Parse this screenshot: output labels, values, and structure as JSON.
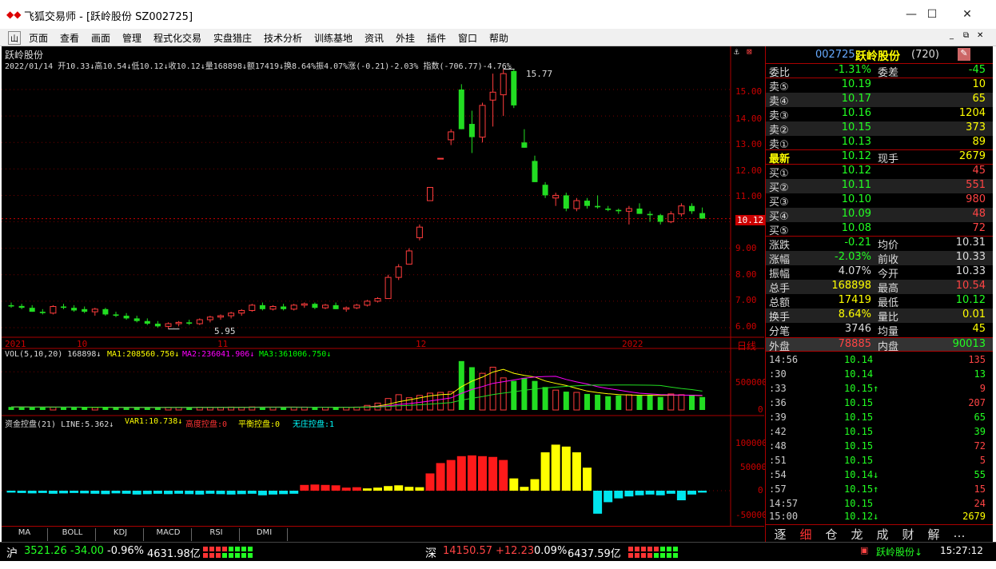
{
  "window": {
    "title": "飞狐交易师 - [跃岭股份 SZ002725]",
    "minimize": "—",
    "maximize": "☐",
    "close": "✕"
  },
  "menu": {
    "icon": "山",
    "items": [
      "页面",
      "查看",
      "画面",
      "管理",
      "程式化交易",
      "实盘猎庄",
      "技术分析",
      "训练基地",
      "资讯",
      "外挂",
      "插件",
      "窗口",
      "帮助"
    ]
  },
  "chart": {
    "stock_name": "跃岭股份",
    "info_line": "2022/01/14 开10.33↓高10.54↓低10.12↓收10.12↓量168898↓额17419↓换8.64%振4.07%涨(-0.21)-2.03% 指数(-706.77)-4.76%",
    "price_ticks": [
      "15.00",
      "14.00",
      "13.00",
      "12.00",
      "11.00",
      "10.12",
      "9.00",
      "8.00",
      "7.00",
      "6.00"
    ],
    "current_price": "10.12",
    "max_label": "15.77",
    "min_label": "5.95",
    "x_labels": [
      "2021",
      "10",
      "11",
      "12",
      "2022"
    ],
    "period": "日线",
    "vol_legend": {
      "main": "VOL(5,10,20) 168898↓",
      "ma1": "MA1:208560.750↓",
      "ma2": "MA2:236041.906↓",
      "ma3": "MA3:361006.750↓"
    },
    "vol_ticks": [
      "500000",
      "0"
    ],
    "fund_legend": {
      "main": "资金控盘(21) LINE:5.362↓",
      "var1": "VAR1:10.738↓",
      "high": "高度控盘:0",
      "balance": "平衡控盘:0",
      "none": "无庄控盘:1"
    },
    "fund_ticks": [
      "100000",
      "50000",
      "0",
      "-50000"
    ],
    "colors": {
      "up": "#ff3c3c",
      "down": "#22dd22",
      "ma1": "#ffffff",
      "ma2": "#ffff00",
      "ma3": "#ff00ff"
    }
  },
  "indicator_tabs": [
    "MA",
    "BOLL",
    "KDJ",
    "MACD",
    "RSI",
    "DMI"
  ],
  "chart_data": {
    "type": "candlestick",
    "series": [
      {
        "name": "daily",
        "ohlc": [
          [
            6.85,
            6.95,
            6.75,
            6.8
          ],
          [
            6.82,
            6.9,
            6.7,
            6.75
          ],
          [
            6.75,
            6.85,
            6.6,
            6.6
          ],
          [
            6.6,
            6.7,
            6.5,
            6.55
          ],
          [
            6.55,
            6.85,
            6.5,
            6.8
          ],
          [
            6.8,
            6.9,
            6.7,
            6.75
          ],
          [
            6.75,
            6.85,
            6.6,
            6.65
          ],
          [
            6.7,
            6.8,
            6.55,
            6.6
          ],
          [
            6.6,
            6.75,
            6.45,
            6.7
          ],
          [
            6.7,
            6.75,
            6.45,
            6.5
          ],
          [
            6.5,
            6.6,
            6.4,
            6.45
          ],
          [
            6.45,
            6.55,
            6.3,
            6.35
          ],
          [
            6.35,
            6.45,
            6.2,
            6.25
          ],
          [
            6.25,
            6.35,
            6.1,
            6.15
          ],
          [
            6.15,
            6.25,
            6.0,
            6.05
          ],
          [
            6.05,
            6.2,
            5.95,
            6.15
          ],
          [
            6.15,
            6.25,
            6.05,
            6.2
          ],
          [
            6.2,
            6.3,
            6.1,
            6.15
          ],
          [
            6.15,
            6.35,
            6.1,
            6.3
          ],
          [
            6.3,
            6.45,
            6.2,
            6.4
          ],
          [
            6.4,
            6.5,
            6.3,
            6.45
          ],
          [
            6.45,
            6.6,
            6.35,
            6.55
          ],
          [
            6.55,
            6.7,
            6.45,
            6.65
          ],
          [
            6.65,
            6.9,
            6.6,
            6.85
          ],
          [
            6.85,
            6.95,
            6.65,
            6.7
          ],
          [
            6.7,
            6.85,
            6.65,
            6.8
          ],
          [
            6.8,
            6.9,
            6.65,
            6.7
          ],
          [
            6.7,
            6.9,
            6.65,
            6.85
          ],
          [
            6.85,
            6.95,
            6.75,
            6.9
          ],
          [
            6.9,
            6.95,
            6.7,
            6.75
          ],
          [
            6.75,
            6.9,
            6.7,
            6.85
          ],
          [
            6.85,
            6.95,
            6.7,
            6.7
          ],
          [
            6.7,
            6.8,
            6.6,
            6.75
          ],
          [
            6.75,
            6.9,
            6.7,
            6.85
          ],
          [
            6.85,
            7.05,
            6.8,
            7.0
          ],
          [
            7.0,
            7.15,
            6.95,
            7.1
          ],
          [
            7.1,
            8.0,
            7.1,
            7.9
          ],
          [
            7.9,
            8.4,
            7.8,
            8.3
          ],
          [
            8.4,
            9.0,
            8.4,
            8.9
          ],
          [
            9.4,
            9.9,
            9.3,
            9.8
          ],
          [
            10.8,
            11.3,
            10.8,
            11.3
          ],
          [
            12.4,
            12.4,
            12.4,
            12.4
          ],
          [
            13.1,
            13.5,
            12.9,
            13.4
          ],
          [
            15.0,
            15.2,
            13.5,
            13.5
          ],
          [
            13.7,
            14.2,
            12.6,
            13.2
          ],
          [
            13.2,
            14.5,
            13.0,
            14.4
          ],
          [
            14.6,
            15.6,
            13.6,
            14.9
          ],
          [
            14.8,
            15.77,
            14.0,
            15.6
          ],
          [
            15.7,
            15.77,
            14.3,
            14.4
          ],
          [
            13.0,
            13.5,
            12.8,
            12.8
          ],
          [
            12.3,
            12.5,
            11.5,
            11.5
          ],
          [
            11.4,
            11.5,
            10.9,
            11.0
          ],
          [
            10.9,
            11.1,
            10.6,
            11.0
          ],
          [
            11.0,
            11.1,
            10.4,
            10.5
          ],
          [
            10.5,
            10.9,
            10.4,
            10.8
          ],
          [
            10.8,
            10.9,
            10.5,
            10.6
          ],
          [
            10.6,
            11.0,
            10.5,
            10.55
          ],
          [
            10.5,
            10.6,
            10.4,
            10.45
          ],
          [
            10.45,
            10.5,
            10.3,
            10.4
          ],
          [
            10.4,
            10.6,
            9.9,
            10.5
          ],
          [
            10.5,
            10.7,
            10.3,
            10.3
          ],
          [
            10.3,
            10.4,
            10.0,
            10.25
          ],
          [
            10.25,
            10.3,
            9.9,
            10.0
          ],
          [
            10.0,
            10.4,
            9.95,
            10.3
          ],
          [
            10.3,
            10.7,
            10.2,
            10.6
          ],
          [
            10.6,
            10.7,
            10.3,
            10.4
          ],
          [
            10.33,
            10.54,
            10.12,
            10.12
          ]
        ]
      }
    ],
    "volume": [
      40000,
      38000,
      36000,
      37000,
      35000,
      38000,
      36000,
      34000,
      33000,
      35000,
      32000,
      31000,
      33000,
      30000,
      32000,
      34000,
      33000,
      35000,
      36000,
      34000,
      35000,
      38000,
      37000,
      40000,
      39000,
      36000,
      35000,
      37000,
      38000,
      36000,
      35000,
      34000,
      36000,
      38000,
      60000,
      90000,
      150000,
      200000,
      160000,
      190000,
      220000,
      230000,
      240000,
      640000,
      560000,
      480000,
      560000,
      420000,
      380000,
      420000,
      380000,
      300000,
      260000,
      240000,
      230000,
      210000,
      200000,
      180000,
      190000,
      200000,
      190000,
      200000,
      170000,
      210000,
      200000,
      190000,
      168898
    ],
    "fund_control": [
      -5000,
      -6000,
      -7000,
      -6000,
      -8000,
      -7000,
      -6000,
      -7000,
      -8000,
      -9000,
      -7000,
      -8000,
      -10000,
      -9000,
      -8000,
      -9000,
      -8000,
      -9000,
      -10000,
      -8000,
      -9000,
      -10000,
      -9000,
      -8000,
      -12000,
      -10000,
      -9000,
      -8000,
      15000,
      16000,
      15000,
      14000,
      8000,
      9000,
      6000,
      8000,
      12000,
      14000,
      10000,
      9000,
      45000,
      72000,
      80000,
      90000,
      92000,
      90000,
      88000,
      80000,
      32000,
      10000,
      30000,
      100000,
      120000,
      115000,
      100000,
      60000,
      -60000,
      -30000,
      -20000,
      -15000,
      -12000,
      -10000,
      -12000,
      -8000,
      -25000,
      -10000,
      -5000
    ]
  },
  "quote": {
    "code": "002725",
    "name": "跃岭股份",
    "extra": "(720)",
    "weibi": {
      "label": "委比",
      "value": "-1.31%",
      "label2": "委差",
      "value2": "-45"
    },
    "sell": [
      {
        "label": "卖⑤",
        "price": "10.19",
        "vol": "10"
      },
      {
        "label": "卖④",
        "price": "10.17",
        "vol": "65"
      },
      {
        "label": "卖③",
        "price": "10.16",
        "vol": "1204"
      },
      {
        "label": "卖②",
        "price": "10.15",
        "vol": "373"
      },
      {
        "label": "卖①",
        "price": "10.13",
        "vol": "89"
      }
    ],
    "latest": {
      "label": "最新",
      "price": "10.12",
      "label2": "现手",
      "vol": "2679"
    },
    "buy": [
      {
        "label": "买①",
        "price": "10.12",
        "vol": "45"
      },
      {
        "label": "买②",
        "price": "10.11",
        "vol": "551"
      },
      {
        "label": "买③",
        "price": "10.10",
        "vol": "980"
      },
      {
        "label": "买④",
        "price": "10.09",
        "vol": "48"
      },
      {
        "label": "买⑤",
        "price": "10.08",
        "vol": "72"
      }
    ],
    "stats": [
      {
        "l": "涨跌",
        "v": "-0.21",
        "l2": "均价",
        "v2": "10.31"
      },
      {
        "l": "涨幅",
        "v": "-2.03%",
        "l2": "前收",
        "v2": "10.33"
      },
      {
        "l": "振幅",
        "v": "4.07%",
        "l2": "今开",
        "v2": "10.33"
      },
      {
        "l": "总手",
        "v": "168898",
        "l2": "最高",
        "v2": "10.54"
      },
      {
        "l": "总额",
        "v": "17419",
        "l2": "最低",
        "v2": "10.12"
      },
      {
        "l": "换手",
        "v": "8.64%",
        "l2": "量比",
        "v2": "0.01"
      },
      {
        "l": "分笔",
        "v": "3746",
        "l2": "均量",
        "v2": "45"
      }
    ],
    "outer": {
      "label": "外盘",
      "value": "78885",
      "label2": "内盘",
      "value2": "90013"
    },
    "ticks": [
      {
        "t": "14:56",
        "p": "10.14",
        "v": "135"
      },
      {
        "t": ":30",
        "p": "10.14",
        "v": "13"
      },
      {
        "t": ":33",
        "p": "10.15↑",
        "v": "9"
      },
      {
        "t": ":36",
        "p": "10.15",
        "v": "207"
      },
      {
        "t": ":39",
        "p": "10.15",
        "v": "65"
      },
      {
        "t": ":42",
        "p": "10.15",
        "v": "39"
      },
      {
        "t": ":48",
        "p": "10.15",
        "v": "72"
      },
      {
        "t": ":51",
        "p": "10.15",
        "v": "5"
      },
      {
        "t": ":54",
        "p": "10.14↓",
        "v": "55"
      },
      {
        "t": ":57",
        "p": "10.15↑",
        "v": "15"
      },
      {
        "t": "14:57",
        "p": "10.15",
        "v": "24"
      },
      {
        "t": "15:00",
        "p": "10.12↓",
        "v": "2679"
      }
    ],
    "tabs": [
      "逐",
      "细",
      "仓",
      "龙",
      "成",
      "财",
      "解",
      "…"
    ]
  },
  "status": {
    "sh_label": "沪",
    "sh_index": "3521.26",
    "sh_change": "-34.00",
    "sh_pct": "-0.96%",
    "sh_amount": "4631.98亿",
    "sz_label": "深",
    "sz_index": "14150.57",
    "sz_change": "+12.23",
    "sz_pct": "0.09%",
    "sz_amount": "6437.59亿",
    "stock": "跃岭股份↓",
    "time": "15:27:12"
  }
}
